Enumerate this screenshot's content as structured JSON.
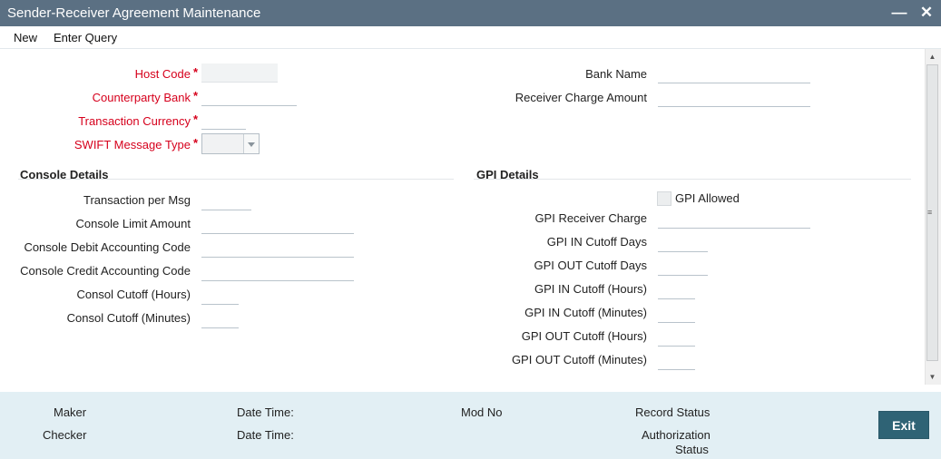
{
  "window": {
    "title": "Sender-Receiver Agreement Maintenance",
    "minimize_icon": "minimize-icon",
    "close_icon": "close-icon"
  },
  "menu": {
    "new_label": "New",
    "enter_query_label": "Enter Query"
  },
  "form": {
    "host_code_label": "Host Code",
    "counterparty_bank_label": "Counterparty Bank",
    "transaction_currency_label": "Transaction Currency",
    "swift_message_type_label": "SWIFT Message Type",
    "required_marker": "*",
    "bank_name_label": "Bank Name",
    "receiver_charge_amount_label": "Receiver Charge Amount"
  },
  "console": {
    "title": "Console Details",
    "transaction_per_msg_label": "Transaction per Msg",
    "console_limit_amount_label": "Console Limit Amount",
    "console_debit_accounting_code_label": "Console Debit Accounting Code",
    "console_credit_accounting_code_label": "Console Credit Accounting Code",
    "consol_cutoff_hours_label": "Consol Cutoff (Hours)",
    "consol_cutoff_minutes_label": "Consol Cutoff (Minutes)"
  },
  "gpi": {
    "title": "GPI Details",
    "gpi_allowed_label": "GPI Allowed",
    "gpi_allowed_checked": false,
    "gpi_receiver_charge_label": "GPI Receiver Charge",
    "gpi_in_cutoff_days_label": "GPI IN Cutoff Days",
    "gpi_out_cutoff_days_label": "GPI OUT Cutoff Days",
    "gpi_in_cutoff_hours_label": "GPI IN Cutoff (Hours)",
    "gpi_in_cutoff_minutes_label": "GPI IN Cutoff (Minutes)",
    "gpi_out_cutoff_hours_label": "GPI OUT Cutoff (Hours)",
    "gpi_out_cutoff_minutes_label": "GPI OUT Cutoff (Minutes)"
  },
  "footer": {
    "maker_label": "Maker",
    "checker_label": "Checker",
    "date_time_label_1": "Date Time:",
    "date_time_label_2": "Date Time:",
    "mod_no_label": "Mod No",
    "record_status_label": "Record Status",
    "authorization_label": "Authorization",
    "status_label": "Status",
    "exit_label": "Exit"
  },
  "colors": {
    "titlebar": "#5b7083",
    "required": "#d6001c",
    "footer": "#e2eff4",
    "exit_button": "#2f6375"
  }
}
